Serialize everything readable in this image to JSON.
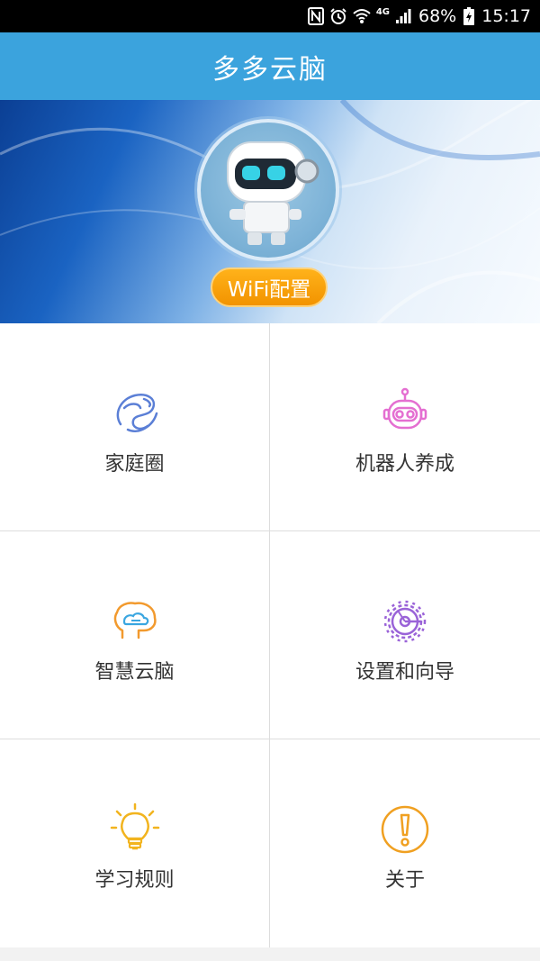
{
  "status_bar": {
    "icons": [
      "nfc-icon",
      "alarm-icon",
      "wifi-icon",
      "cellular-signal-icon",
      "battery-charging-icon"
    ],
    "network": "4G",
    "battery": "68%",
    "time": "15:17"
  },
  "app_bar": {
    "title": "多多云脑"
  },
  "banner": {
    "wifi_button_label": "WiFi配置"
  },
  "menu": {
    "items": [
      {
        "label": "家庭圈",
        "icon": "family-circle-icon",
        "color": "#5b7fd6"
      },
      {
        "label": "机器人养成",
        "icon": "robot-icon",
        "color": "#e46fd1"
      },
      {
        "label": "智慧云脑",
        "icon": "cloud-brain-icon",
        "color": "#f29a2e"
      },
      {
        "label": "设置和向导",
        "icon": "gear-icon",
        "color": "#9a63d8"
      },
      {
        "label": "学习规则",
        "icon": "lightbulb-icon",
        "color": "#f2b41f"
      },
      {
        "label": "关于",
        "icon": "info-exclamation-icon",
        "color": "#f0a021"
      }
    ]
  },
  "colors": {
    "app_bar": "#3ba3dd",
    "wifi_button": "#f7a10d"
  }
}
